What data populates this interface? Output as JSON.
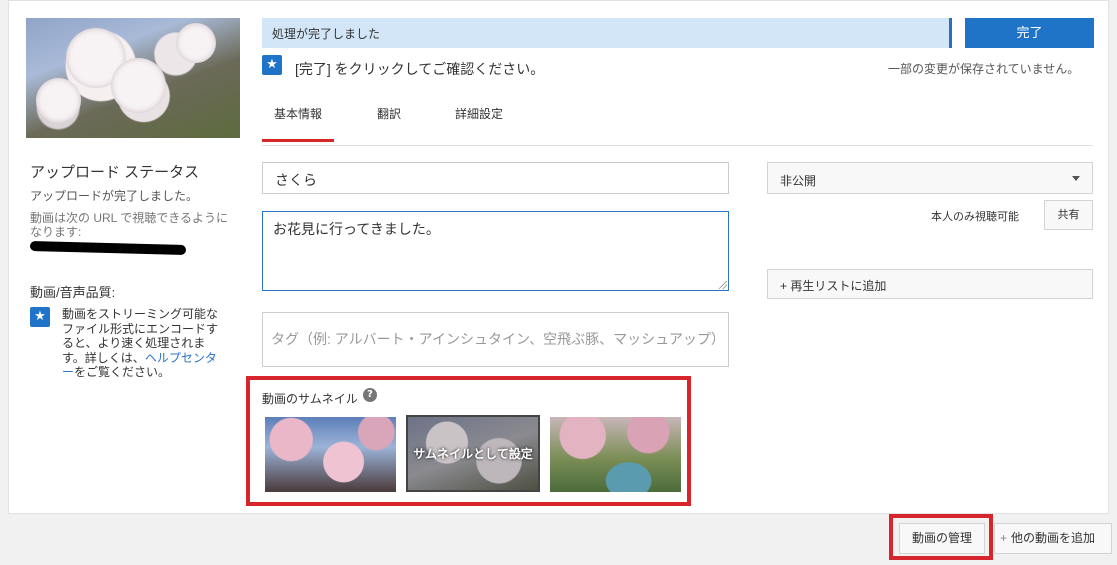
{
  "progress": {
    "text": "処理が完了しました"
  },
  "done_button": "完了",
  "confirm_text": "[完了] をクリックしてご確認ください。",
  "unsaved_text": "一部の変更が保存されていません。",
  "tabs": [
    {
      "label": "基本情報",
      "active": true
    },
    {
      "label": "翻訳",
      "active": false
    },
    {
      "label": "詳細設定",
      "active": false
    }
  ],
  "sidebar": {
    "status_title": "アップロード ステータス",
    "status_sub": "アップロードが完了しました。",
    "status_url_text": "動画は次の URL で視聴できるようになります:",
    "quality_title": "動画/音声品質:",
    "quality_text": "動画をストリーミング可能なファイル形式にエンコードすると、より速く処理されます。詳しくは、",
    "help_link": "ヘルプセンター",
    "quality_suffix": "をご覧ください。"
  },
  "form": {
    "title_value": "さくら",
    "description_value": "お花見に行ってきました。",
    "tags_placeholder": "タグ（例: アルバート・アインシュタイン、空飛ぶ豚、マッシュアップ）"
  },
  "privacy": {
    "selected": "非公開",
    "note": "本人のみ視聴可能",
    "share_button": "共有",
    "playlist_button": "+ 再生リストに追加"
  },
  "thumbnails": {
    "label": "動画のサムネイル",
    "help_icon": "?",
    "set_thumbnail_label": "サムネイルとして設定",
    "selected_index": 1
  },
  "footer": {
    "manage_button": "動画の管理",
    "add_button": "他の動画を追加",
    "add_icon": "+"
  },
  "colors": {
    "accent": "#1f74c8",
    "highlight": "#d7252e",
    "progress_bg": "#d2e6f8"
  }
}
